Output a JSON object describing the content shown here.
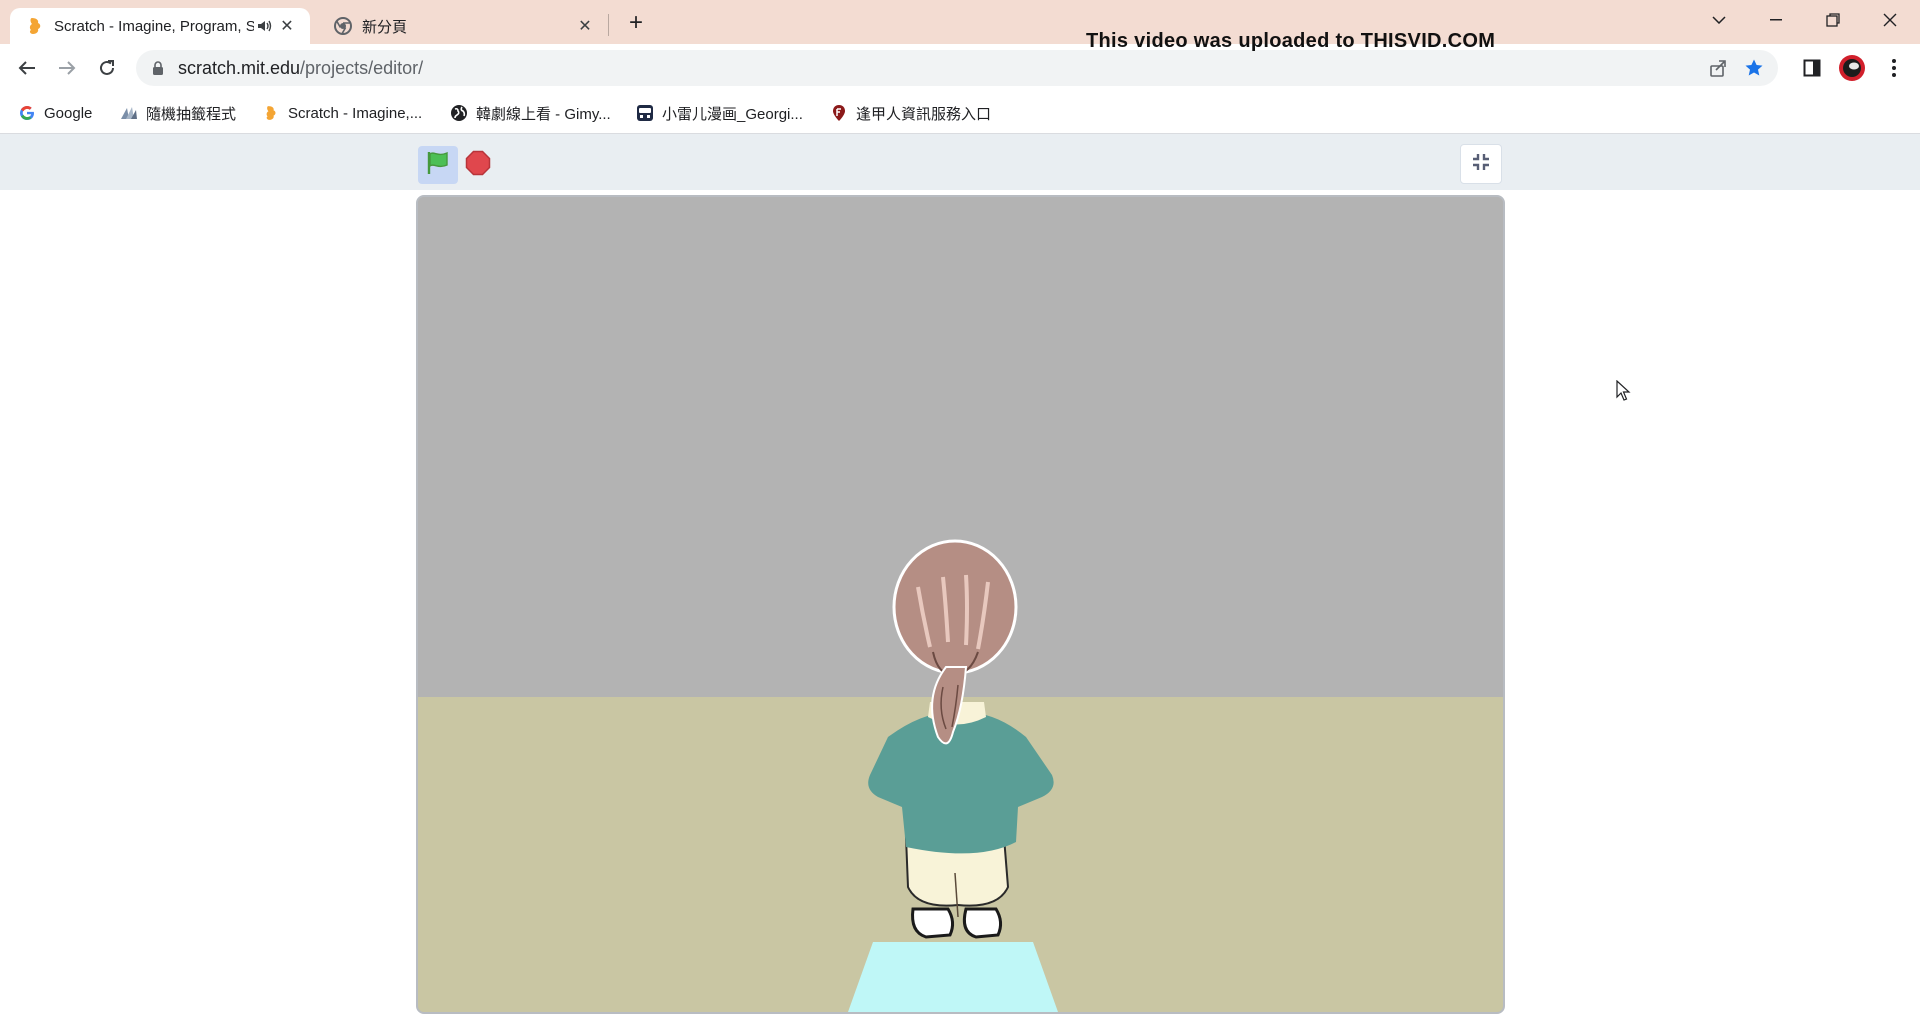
{
  "browser": {
    "tabs": [
      {
        "title": "Scratch - Imagine, Program, Share",
        "active": true,
        "audible": true
      },
      {
        "title": "新分頁",
        "active": false,
        "audible": false
      }
    ],
    "url": {
      "host": "scratch.mit.edu",
      "path": "/projects/editor/"
    },
    "bookmarks": [
      {
        "label": "Google",
        "icon": "google-icon"
      },
      {
        "label": "隨機抽籤程式",
        "icon": "draw-lots-icon"
      },
      {
        "label": "Scratch - Imagine,...",
        "icon": "scratch-icon"
      },
      {
        "label": "韓劇線上看 - Gimy...",
        "icon": "globe-icon"
      },
      {
        "label": "小雷儿漫画_Georgi...",
        "icon": "comic-icon"
      },
      {
        "label": "逢甲人資訊服務入口",
        "icon": "fcu-icon"
      }
    ]
  },
  "overlay": {
    "watermark": "This video was uploaded to THISVID.COM"
  },
  "scratch_player": {
    "controls": [
      "green-flag",
      "stop",
      "exit-fullscreen"
    ],
    "stage": {
      "backdrop": {
        "wall_color": "#b3b3b3",
        "floor_color": "#c9c6a3",
        "mat_color": "#bff7f7"
      },
      "sprite": {
        "description_colors": {
          "hair": "#b58e84",
          "shirt": "#5a9e96",
          "pants": "#f8f3d8",
          "shoes": "#ffffff"
        }
      }
    }
  },
  "colors": {
    "tab_strip": "#f3dcd2",
    "accent_star": "#1a73e8",
    "stop_red": "#e0474d",
    "flag_green": "#4cbf56"
  }
}
